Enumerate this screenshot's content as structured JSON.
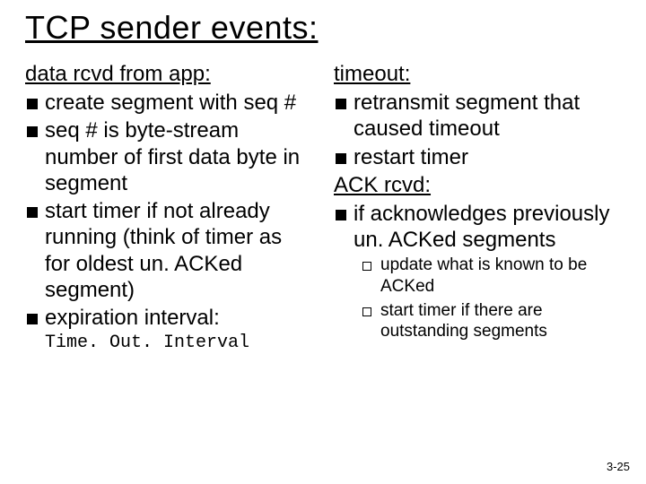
{
  "title": "TCP sender events:",
  "left": {
    "heading": "data rcvd from app:",
    "items": [
      "create segment with seq #",
      "seq # is byte-stream number of first data byte in  segment",
      "start timer if not already running (think of timer as for oldest un. ACKed segment)",
      "expiration interval:"
    ],
    "code": "Time. Out. Interval"
  },
  "right": {
    "heading1": "timeout:",
    "items1": [
      "retransmit segment that caused timeout",
      "restart timer"
    ],
    "heading2": "ACK rcvd:",
    "items2": [
      "if acknowledges previously un. ACKed segments"
    ],
    "sub_items": [
      "update what is known to be ACKed",
      "start timer if there are outstanding segments"
    ]
  },
  "page_number": "3-25"
}
